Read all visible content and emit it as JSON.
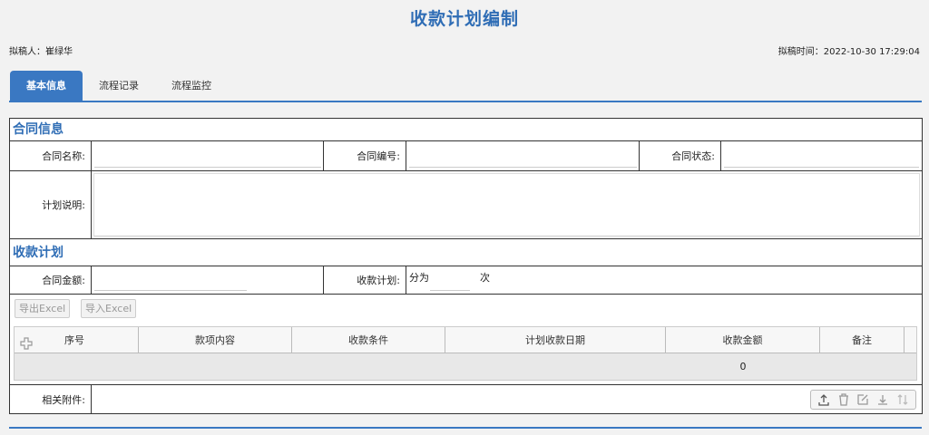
{
  "page": {
    "title": "收款计划编制",
    "drafter": "拟稿人：崔绿华",
    "draft_time": "拟稿时间：2022-10-30 17:29:04"
  },
  "tabs": [
    "基本信息",
    "流程记录",
    "流程监控"
  ],
  "contract_section": {
    "title": "合同信息",
    "name_label": "合同名称:",
    "no_label": "合同编号:",
    "status_label": "合同状态:",
    "desc_label": "计划说明:"
  },
  "plan_section": {
    "title": "收款计划",
    "amount_label": "合同金额:",
    "plan_label": "收款计划:",
    "split_prefix": "分为",
    "split_suffix": "次"
  },
  "grid": {
    "export_label": "导出Excel",
    "import_label": "导入Excel",
    "columns": [
      "序号",
      "款项内容",
      "收款条件",
      "计划收款日期",
      "收款金额",
      "备注"
    ],
    "total_amount": "0"
  },
  "attachments": {
    "label": "相关附件:"
  },
  "colors": {
    "accent": "#3a78c2",
    "title": "#2f6db5"
  },
  "icons": [
    "plus-icon",
    "upload-icon",
    "trash-icon",
    "edit-icon",
    "download-icon",
    "sort-icon"
  ]
}
